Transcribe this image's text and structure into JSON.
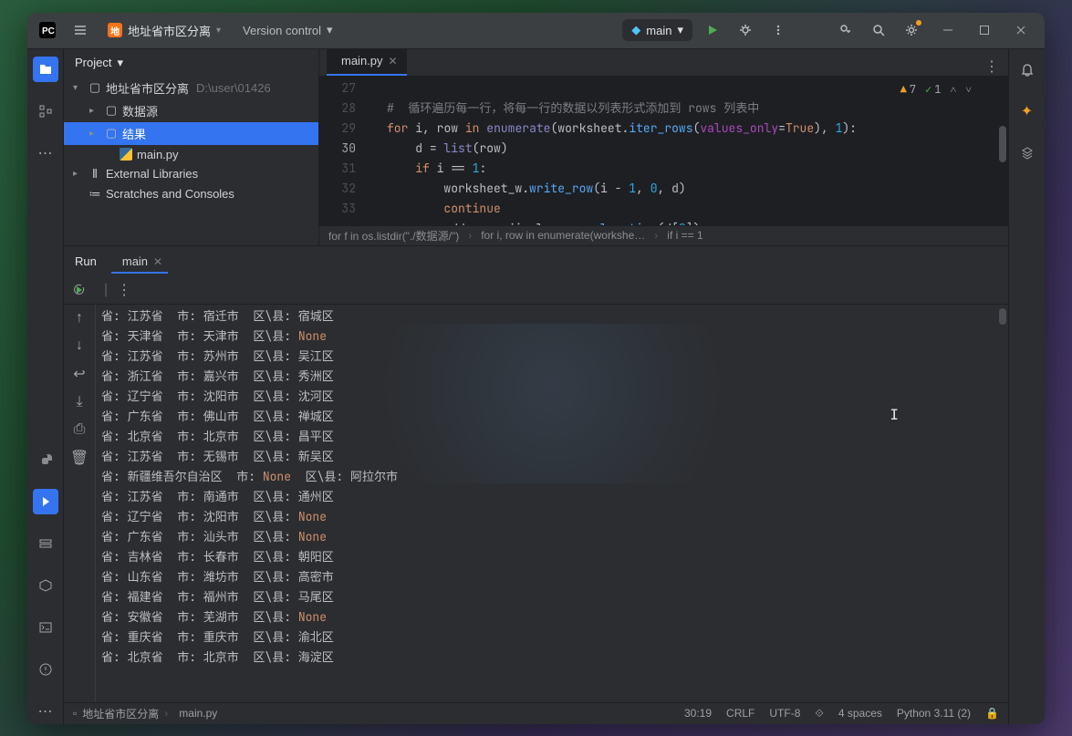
{
  "titlebar": {
    "project_name": "地址省市区分离",
    "vcs_label": "Version control",
    "run_config_name": "main"
  },
  "project": {
    "header": "Project",
    "root_name": "地址省市区分离",
    "root_path": "D:\\user\\01426",
    "folders": [
      "数据源",
      "结果"
    ],
    "file": "main.py",
    "ext_lib": "External Libraries",
    "scratches": "Scratches and Consoles"
  },
  "editor": {
    "tab_name": "main.py",
    "warn_count": "7",
    "check_count": "1",
    "lines": [
      {
        "n": 27
      },
      {
        "n": 28
      },
      {
        "n": 29
      },
      {
        "n": 30
      },
      {
        "n": 31
      },
      {
        "n": 32
      },
      {
        "n": 33
      }
    ],
    "breadcrumbs": [
      "for f in os.listdir(\"./数据源/\")",
      "for i, row in enumerate(workshe…",
      "if i == 1"
    ]
  },
  "run": {
    "label": "Run",
    "tab": "main",
    "lines": [
      {
        "p": "江苏省",
        "c": "宿迁市",
        "d": "宿城区"
      },
      {
        "p": "天津省",
        "c": "天津市",
        "d": null
      },
      {
        "p": "江苏省",
        "c": "苏州市",
        "d": "吴江区"
      },
      {
        "p": "浙江省",
        "c": "嘉兴市",
        "d": "秀洲区"
      },
      {
        "p": "辽宁省",
        "c": "沈阳市",
        "d": "沈河区"
      },
      {
        "p": "广东省",
        "c": "佛山市",
        "d": "禅城区"
      },
      {
        "p": "北京省",
        "c": "北京市",
        "d": "昌平区"
      },
      {
        "p": "江苏省",
        "c": "无锡市",
        "d": "新吴区"
      },
      {
        "p": "新疆维吾尔自治区",
        "c": null,
        "d": "阿拉尔市"
      },
      {
        "p": "江苏省",
        "c": "南通市",
        "d": "通州区"
      },
      {
        "p": "辽宁省",
        "c": "沈阳市",
        "d": null
      },
      {
        "p": "广东省",
        "c": "汕头市",
        "d": null
      },
      {
        "p": "吉林省",
        "c": "长春市",
        "d": "朝阳区"
      },
      {
        "p": "山东省",
        "c": "潍坊市",
        "d": "高密市"
      },
      {
        "p": "福建省",
        "c": "福州市",
        "d": "马尾区"
      },
      {
        "p": "安徽省",
        "c": "芜湖市",
        "d": null
      },
      {
        "p": "重庆省",
        "c": "重庆市",
        "d": "渝北区"
      },
      {
        "p": "北京省",
        "c": "北京市",
        "d": "海淀区"
      }
    ]
  },
  "statusbar": {
    "project": "地址省市区分离",
    "file": "main.py",
    "pos": "30:19",
    "eol": "CRLF",
    "enc": "UTF-8",
    "indent": "4 spaces",
    "interp": "Python 3.11 (2)"
  }
}
